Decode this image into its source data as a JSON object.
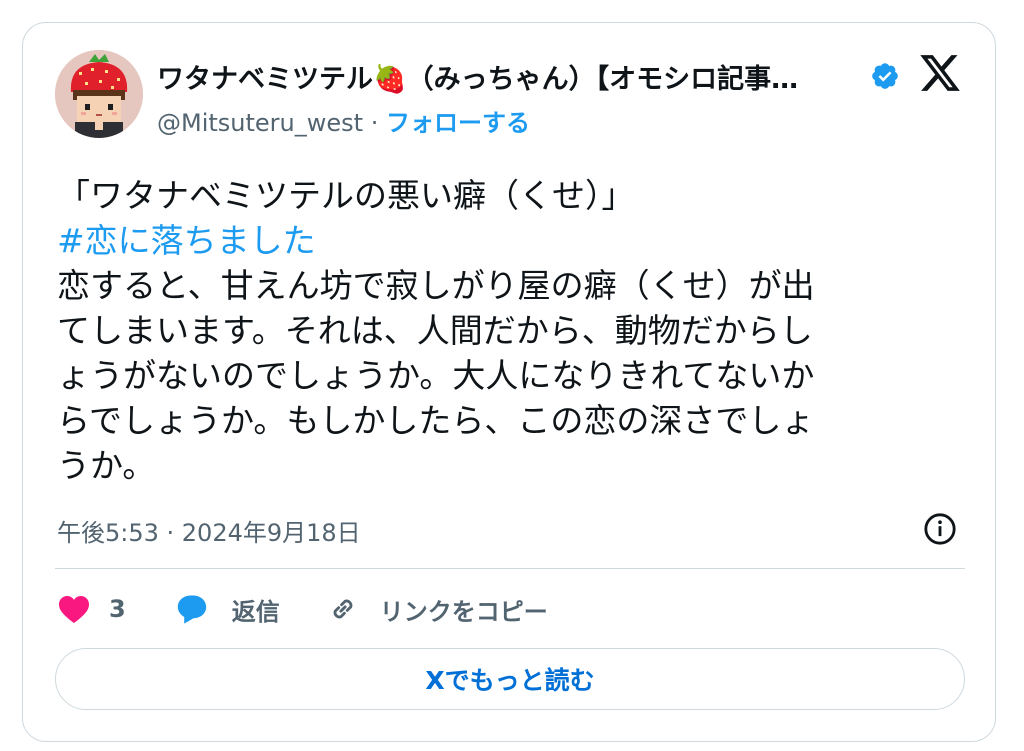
{
  "author": {
    "display_name": "ワタナベミツテル🍓（みっちゃん）【オモシロ記事…",
    "handle": "@Mitsuteru_west",
    "separator": "·",
    "follow_label": "フォローする",
    "verified": true
  },
  "tweet": {
    "lines": [
      "「ワタナベミツテルの悪い癖（くせ）」",
      "#恋に落ちました",
      "恋すると、甘えん坊で寂しがり屋の癖（くせ）が出",
      "てしまいます。それは、人間だから、動物だからし",
      "ょうがないのでしょうか。大人になりきれてないか",
      "らでしょうか。もしかしたら、この恋の深さでしょ",
      "うか。"
    ],
    "timestamp": "午後5:53 · 2024年9月18日"
  },
  "actions": {
    "like_count": "3",
    "reply_label": "返信",
    "copy_link_label": "リンクをコピー"
  },
  "read_more_label": "Xでもっと読む",
  "colors": {
    "accent": "#1d9bf0",
    "link_dark": "#006fd6",
    "text": "#0f1419",
    "secondary": "#536471",
    "like": "#f91880",
    "border": "#cfd9de"
  },
  "icons": {
    "verified": "verified-badge-icon",
    "platform": "x-logo-icon",
    "info": "info-icon",
    "like": "heart-icon",
    "reply": "speech-bubble-icon",
    "copy": "link-icon"
  }
}
